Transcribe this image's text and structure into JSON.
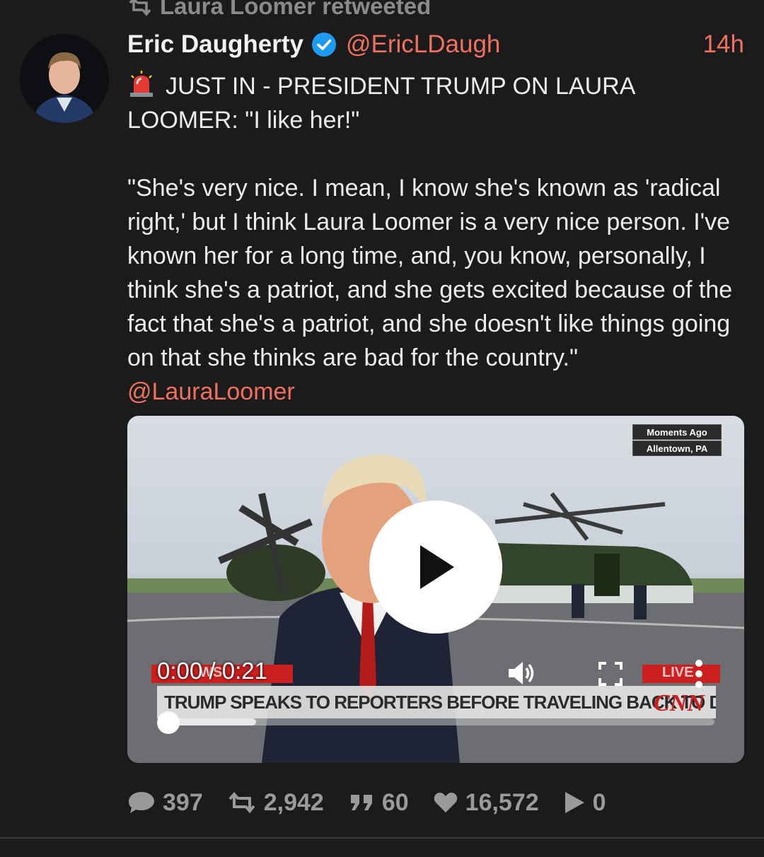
{
  "retweet_banner": {
    "icon": "retweet-icon",
    "text": "Laura Loomer retweeted"
  },
  "author": {
    "name": "Eric Daugherty",
    "verified_icon": "verified-badge-icon",
    "handle": "@EricLDaugh",
    "time": "14h"
  },
  "tweet": {
    "emoji": "police-siren-emoji",
    "line1": "JUST IN - PRESIDENT TRUMP ON LAURA LOOMER: \"I like her!\"",
    "quote": "\"She's very nice. I mean, I know she's known as 'radical right,' but I think Laura Loomer is a very nice person. I've known her for a long time, and, you know, personally, I think she's a patriot, and she gets excited because of the fact that she's a patriot, and she doesn't like things going on that she thinks are bad for the country.\"",
    "mention": "@LauraLoomer"
  },
  "video": {
    "overlay_top": "Moments Ago",
    "overlay_location": "Allentown, PA",
    "time_readout": "0:00 / 0:21",
    "breaking_text": "WS",
    "live_text": "LIVE",
    "ticker": "TRUMP SPEAKS TO REPORTERS BEFORE TRAVELING BACK TO DC",
    "network_logo": "CNN",
    "progress_fraction": 0.0,
    "buffered_fraction": 0.16,
    "play_icon": "play-icon",
    "volume_icon": "volume-icon",
    "fullscreen_icon": "fullscreen-icon",
    "more_icon": "more-vertical-icon"
  },
  "actions": {
    "replies": "397",
    "retweets": "2,942",
    "quotes": "60",
    "likes": "16,572",
    "views": "0"
  },
  "colors": {
    "background": "#1b1b1b",
    "accent": "#f0705e",
    "verified": "#1d9bf0",
    "muted": "#9a9a9a"
  }
}
